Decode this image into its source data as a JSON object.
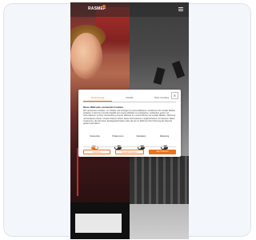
{
  "header": {
    "logo_text": "RASMEF",
    "brand_color": "#e8731f",
    "menu_icon": "hamburger-icon"
  },
  "cookie_modal": {
    "close_label": "✕",
    "tabs": [
      {
        "label": "Zustimmung",
        "active": true
      },
      {
        "label": "Details",
        "active": false
      },
      {
        "label": "Über Cookies",
        "active": false
      }
    ],
    "heading": "Diese Webseite verwendet Cookies",
    "body": "Wir verwenden Cookies, um Inhalte und Anzeigen zu personalisieren, Funktionen für soziale Medien anbieten zu können und die Zugriffe auf unsere Website zu analysieren. Außerdem geben wir Informationen zu Ihrer Verwendung unserer Website an unsere Partner für soziale Medien, Werbung und Analysen weiter. Unsere Partner führen diese Informationen möglicherweise mit weiteren Daten zusammen, die Sie ihnen bereitgestellt haben oder die sie im Rahmen Ihrer Nutzung der Dienste gesammelt haben.",
    "toggles": [
      {
        "label": "Notwendig",
        "on": true
      },
      {
        "label": "Präferenzen",
        "on": false
      },
      {
        "label": "Statistiken",
        "on": false
      },
      {
        "label": "Marketing",
        "on": false
      }
    ],
    "buttons": {
      "deny": "Ablehnen",
      "allow_selection": "Auswahl erlauben",
      "allow_all": "Alle zulassen"
    }
  }
}
